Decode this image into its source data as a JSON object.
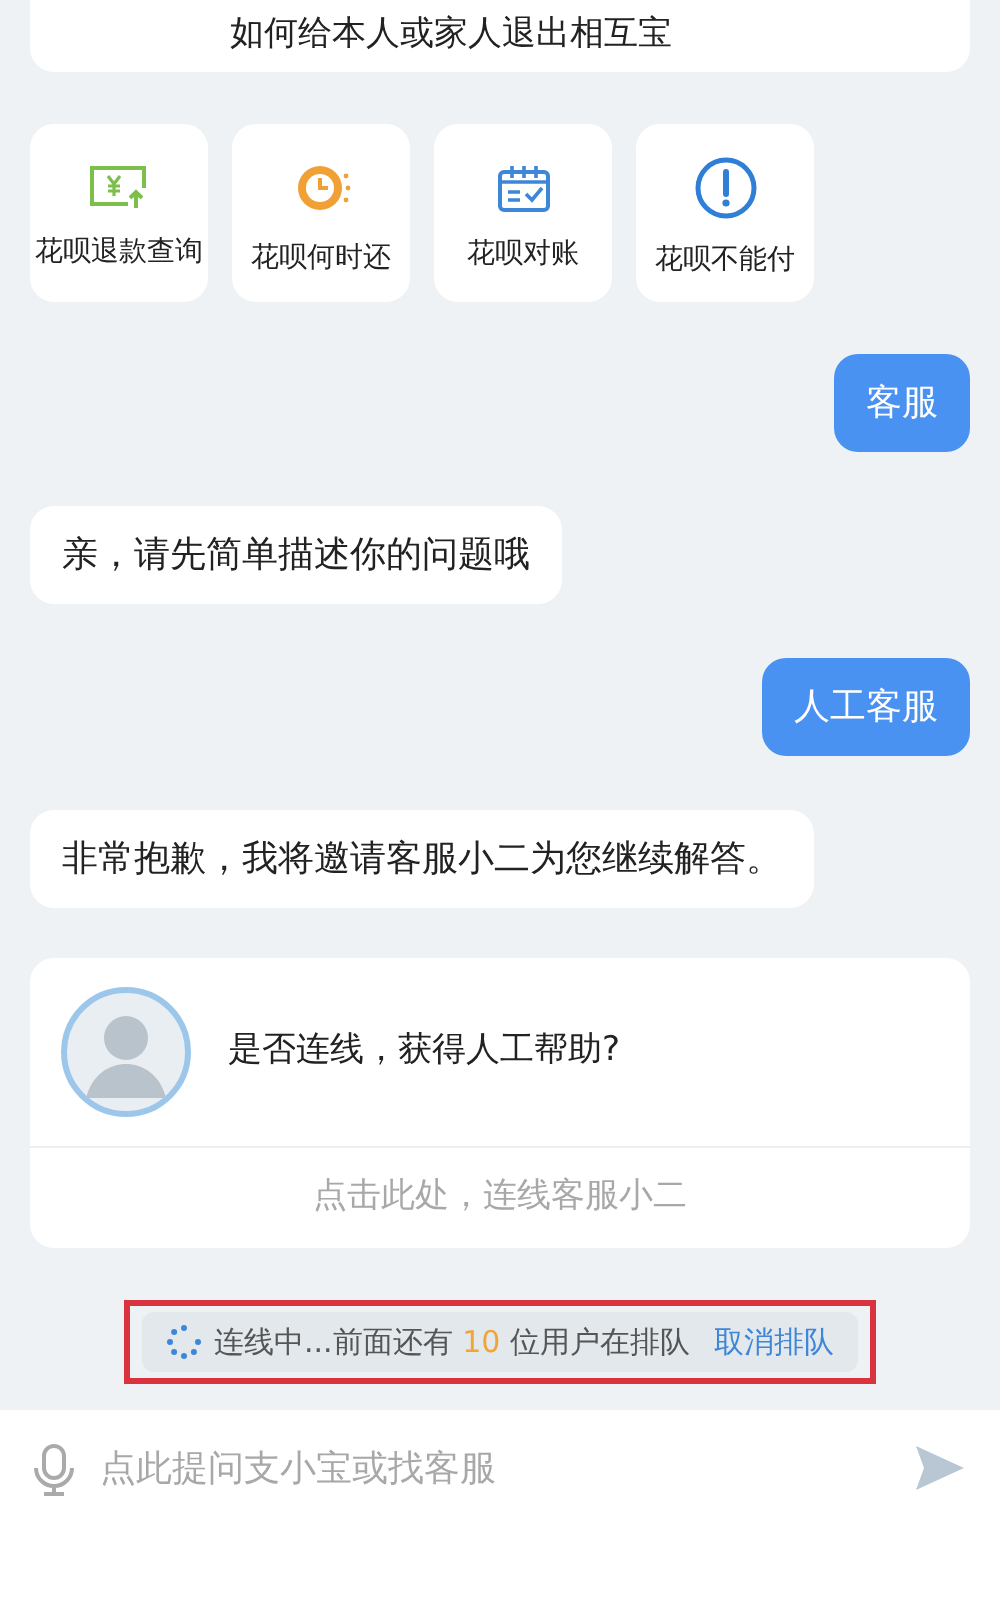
{
  "top_card": {
    "text": "如何给本人或家人退出相互宝"
  },
  "shortcuts": [
    {
      "kind": "refund",
      "label": "花呗退款查询"
    },
    {
      "kind": "clock",
      "label": "花呗何时还"
    },
    {
      "kind": "calendar",
      "label": "花呗对账"
    },
    {
      "kind": "alert",
      "label": "花呗不能付"
    }
  ],
  "messages": [
    {
      "kind": "user",
      "text": "客服"
    },
    {
      "kind": "agent",
      "text": "亲，请先简单描述你的问题哦"
    },
    {
      "kind": "user",
      "text": "人工客服"
    },
    {
      "kind": "agent",
      "text": "非常抱歉，我将邀请客服小二为您继续解答。"
    }
  ],
  "connect_card": {
    "question": "是否连线，获得人工帮助?",
    "action": "点击此处，连线客服小二"
  },
  "queue": {
    "prefix": "连线中...前面还有",
    "count": "10",
    "suffix": "位用户在排队",
    "cancel": "取消排队"
  },
  "input": {
    "placeholder": "点此提问支小宝或找客服"
  }
}
